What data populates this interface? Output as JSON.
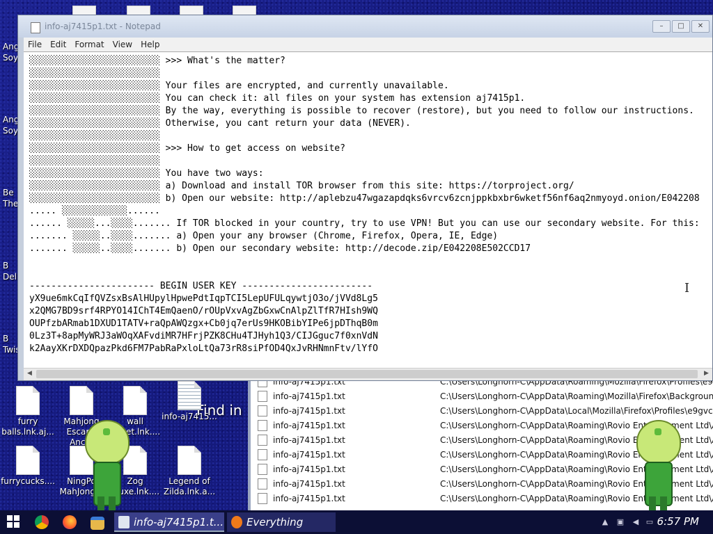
{
  "colors": {
    "desktop": "#1a1f86",
    "taskbar": "#0c0f35",
    "notepad_title_text": "#7a8699"
  },
  "notepad": {
    "title": "info-aj7415p1.txt - Notepad",
    "menu": [
      "File",
      "Edit",
      "Format",
      "View",
      "Help"
    ],
    "window_buttons": {
      "minimize": "–",
      "maximize": "□",
      "close": "✕"
    },
    "lines": [
      "░░░░░░░░░░░░░░░░░░░░░░░░ >>> What's the matter?",
      "░░░░░░░░░░░░░░░░░░░░░░░░",
      "░░░░░░░░░░░░░░░░░░░░░░░░ Your files are encrypted, and currently unavailable.",
      "░░░░░░░░░░░░░░░░░░░░░░░░ You can check it: all files on your system has extension aj7415p1.",
      "░░░░░░░░░░░░░░░░░░░░░░░░ By the way, everything is possible to recover (restore), but you need to follow our instructions.",
      "░░░░░░░░░░░░░░░░░░░░░░░░ Otherwise, you cant return your data (NEVER).",
      "░░░░░░░░░░░░░░░░░░░░░░░░",
      "░░░░░░░░░░░░░░░░░░░░░░░░ >>> How to get access on website?",
      "░░░░░░░░░░░░░░░░░░░░░░░░",
      "░░░░░░░░░░░░░░░░░░░░░░░░ You have two ways:",
      "░░░░░░░░░░░░░░░░░░░░░░░░ a) Download and install TOR browser from this site: https://torproject.org/",
      "░░░░░░░░░░░░░░░░░░░░░░░░ b) Open our website: http://aplebzu47wgazapdqks6vrcv6zcnjppkbxbr6wketf56nf6aq2nmyoyd.onion/E042208",
      "..... ░░░░░░░░░░░░......",
      "...... ░░░░░...░░░░....... If TOR blocked in your country, try to use VPN! But you can use our secondary website. For this:",
      "....... ░░░░░..░░░░....... a) Open your any browser (Chrome, Firefox, Opera, IE, Edge)",
      "....... ░░░░░..░░░░....... b) Open our secondary website: http://decode.zip/E042208E502CCD17",
      "",
      "",
      "----------------------- BEGIN USER KEY ------------------------",
      "yX9ue6mkCqIfQVZsxBsAlHUpylHpwePdtIqpTCI5LepUFULqywtjO3o/jVVd8Lg5",
      "x2QMG7BD9srf4RPYO14IChT4EmQaenO/rOUpVxvAgZbGxwCnAlpZlTfR7HIsh9WQ",
      "OUPfzbARmab1DXUD1TATV+raQpAWQzgx+Cb0jq7erUs9HKOBibYIPe6jpDThqB0m",
      "0Lz3T+8apMyWRJ3aWOqXAFvdiMR7HFrjPZK8CHu4TJHyh1Q3/CIJGguc7f0xnVdN",
      "k2AayXKrDXDQpazPkd6FM7PabRaPxloLtQa73rR8siPfOD4QxJvRHNmnFtv/lYfO"
    ]
  },
  "everything": {
    "search_label": "Find in",
    "rows": [
      {
        "name": "info-aj7415p1.txt",
        "path": "C:\\Users\\Longhorn-C\\AppData\\Roaming\\Mozilla\\Firefox\\Profiles\\e9gvcly"
      },
      {
        "name": "info-aj7415p1.txt",
        "path": "C:\\Users\\Longhorn-C\\AppData\\Roaming\\Mozilla\\Firefox\\Background Tas"
      },
      {
        "name": "info-aj7415p1.txt",
        "path": "C:\\Users\\Longhorn-C\\AppData\\Local\\Mozilla\\Firefox\\Profiles\\e9gvclyv"
      },
      {
        "name": "info-aj7415p1.txt",
        "path": "C:\\Users\\Longhorn-C\\AppData\\Roaming\\Rovio Entertainment Ltd\\Angry"
      },
      {
        "name": "info-aj7415p1.txt",
        "path": "C:\\Users\\Longhorn-C\\AppData\\Roaming\\Rovio Entertainment Ltd\\Angry"
      },
      {
        "name": "info-aj7415p1.txt",
        "path": "C:\\Users\\Longhorn-C\\AppData\\Roaming\\Rovio Entertainment Ltd\\Angry"
      },
      {
        "name": "info-aj7415p1.txt",
        "path": "C:\\Users\\Longhorn-C\\AppData\\Roaming\\Rovio Entertainment Ltd\\Angry"
      },
      {
        "name": "info-aj7415p1.txt",
        "path": "C:\\Users\\Longhorn-C\\AppData\\Roaming\\Rovio Entertainment Ltd\\Angry"
      },
      {
        "name": "info-aj7415p1.txt",
        "path": "C:\\Users\\Longhorn-C\\AppData\\Roaming\\Rovio Entertainment Ltd\\Angry"
      }
    ]
  },
  "desktop": {
    "left_strip": [
      "Ang",
      "Soy",
      "Ang",
      "Soy",
      "Be",
      "The",
      "B",
      "Delu",
      "B",
      "Twis"
    ],
    "icons": [
      {
        "label": "furry balls.lnk.aj...",
        "type": "file"
      },
      {
        "label": "Mahjong Escape Anc...",
        "type": "file"
      },
      {
        "label": "wall street.lnk....",
        "type": "file"
      },
      {
        "label": "info-aj7415...",
        "type": "txt"
      },
      {
        "label": "furrycucks....",
        "type": "file"
      },
      {
        "label": "NingPo MahJong...",
        "type": "file"
      },
      {
        "label": "Zog ...uxe.lnk....",
        "type": "file"
      },
      {
        "label": "Legend of Zilda.lnk.a...",
        "type": "file"
      }
    ]
  },
  "taskbar": {
    "tasks": [
      {
        "label": "info-aj7415p1.t...",
        "icon": "notepad-icon"
      },
      {
        "label": "Everything",
        "icon": "everything-icon"
      }
    ],
    "pinned": [
      "start-icon",
      "chrome-icon",
      "firefox-icon",
      "file-explorer-icon"
    ],
    "clock": "6:57 PM"
  }
}
